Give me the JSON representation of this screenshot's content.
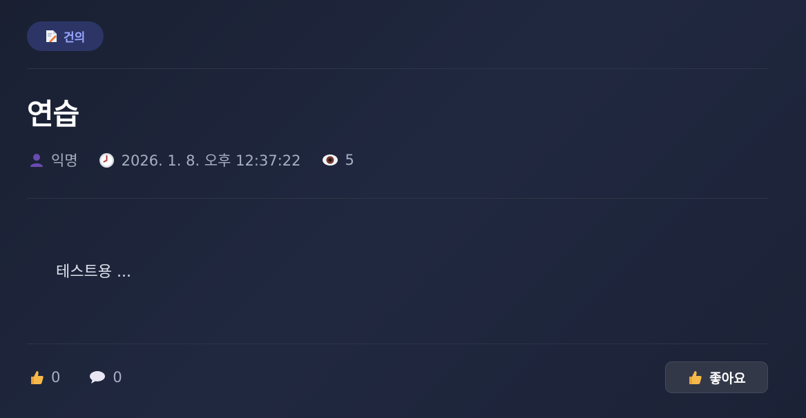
{
  "post": {
    "category": "건의",
    "title": "연습",
    "author": "익명",
    "timestamp": "2026. 1. 8. 오후 12:37:22",
    "views": "5",
    "body": "테스트용 ..."
  },
  "stats": {
    "likes": "0",
    "comments": "0"
  },
  "actions": {
    "like_label": "좋아요"
  },
  "icons": {
    "category": "document-icon",
    "author": "user-icon",
    "time": "clock-icon",
    "views": "eye-icon",
    "likes": "thumbs-up-icon",
    "comments": "speech-bubble-icon"
  },
  "colors": {
    "accent": "#9aa6ff",
    "pill_bg": "#2c3566",
    "background": "#1d2336"
  }
}
